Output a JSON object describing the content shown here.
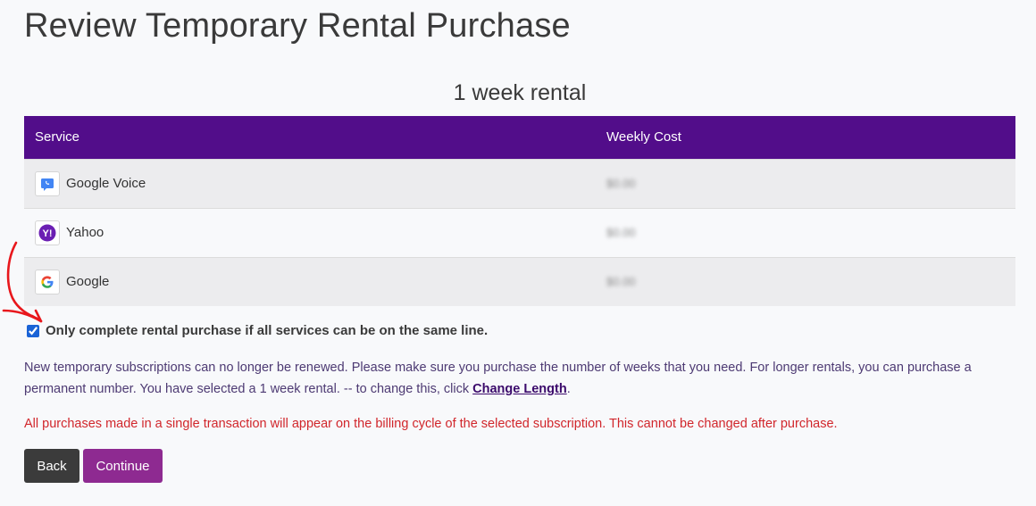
{
  "page": {
    "title": "Review Temporary Rental Purchase",
    "rental_heading": "1 week rental"
  },
  "table": {
    "headers": {
      "service": "Service",
      "cost": "Weekly Cost"
    },
    "rows": [
      {
        "service": "Google Voice",
        "icon": "google-voice-icon",
        "cost": "$0.00"
      },
      {
        "service": "Yahoo",
        "icon": "yahoo-icon",
        "cost": "$0.00"
      },
      {
        "service": "Google",
        "icon": "google-icon",
        "cost": "$0.00"
      }
    ]
  },
  "same_line": {
    "label": "Only complete rental purchase if all services can be on the same line.",
    "checked": true
  },
  "info": {
    "text": "New temporary subscriptions can no longer be renewed. Please make sure you purchase the number of weeks that you need. For longer rentals, you can purchase a permanent number. You have selected a 1 week rental. -- to change this, click ",
    "link": "Change Length",
    "suffix": "."
  },
  "warning": {
    "text": "All purchases made in a single transaction will appear on the billing cycle of the selected subscription. This cannot be changed after purchase."
  },
  "buttons": {
    "back": "Back",
    "continue": "Continue"
  },
  "colors": {
    "header_bg": "#520d8a",
    "continue_bg": "#8e2a91",
    "back_bg": "#3b3b3b",
    "warning": "#d1262b",
    "annotation_arrow": "#e8171c"
  }
}
